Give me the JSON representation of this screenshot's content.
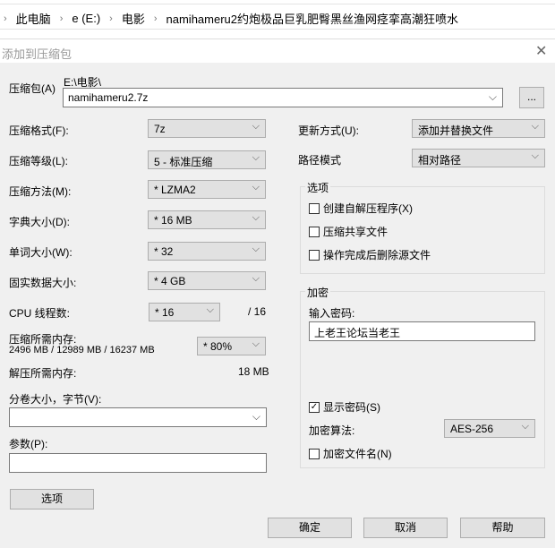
{
  "breadcrumb": [
    "此电脑",
    "e (E:)",
    "电影",
    "namihameru2约炮极品巨乳肥臀黑丝渔网痉挛高潮狂喷水"
  ],
  "dialog": {
    "title": "添加到压缩包",
    "close": "✕"
  },
  "archive": {
    "label": "压缩包(A)",
    "path": "E:\\电影\\",
    "value": "namihameru2.7z",
    "browse": "..."
  },
  "left": {
    "format": {
      "label": "压缩格式(F):",
      "value": "7z"
    },
    "level": {
      "label": "压缩等级(L):",
      "value": "5 - 标准压缩"
    },
    "method": {
      "label": "压缩方法(M):",
      "value": "* LZMA2"
    },
    "dict": {
      "label": "字典大小(D):",
      "value": "* 16 MB"
    },
    "word": {
      "label": "单词大小(W):",
      "value": "* 32"
    },
    "solid": {
      "label": "固实数据大小:",
      "value": "* 4 GB"
    },
    "cpu": {
      "label": "CPU 线程数:",
      "value": "* 16",
      "max": "/ 16"
    },
    "mem": {
      "label": "压缩所需内存:",
      "detail": "2496 MB / 12989 MB / 16237 MB",
      "value": "* 80%"
    },
    "demem": {
      "label": "解压所需内存:",
      "value": "18 MB"
    },
    "volume": {
      "label": "分卷大小，字节(V):",
      "value": ""
    },
    "params": {
      "label": "参数(P):",
      "value": ""
    },
    "options_button": "选项"
  },
  "right": {
    "update": {
      "label": "更新方式(U):",
      "value": "添加并替换文件"
    },
    "pathmode": {
      "label": "路径模式",
      "value": "相对路径"
    },
    "options": {
      "title": "选项",
      "items": [
        {
          "label": "创建自解压程序(X)",
          "checked": false
        },
        {
          "label": "压缩共享文件",
          "checked": false
        },
        {
          "label": "操作完成后删除源文件",
          "checked": false
        }
      ]
    },
    "encryption": {
      "title": "加密",
      "pw_label": "输入密码:",
      "password": "上老王论坛当老王",
      "show_pw": "显示密码(S)",
      "method_label": "加密算法:",
      "method": "AES-256",
      "encrypt_names": "加密文件名(N)"
    }
  },
  "buttons": {
    "ok": "确定",
    "cancel": "取消",
    "help": "帮助"
  }
}
